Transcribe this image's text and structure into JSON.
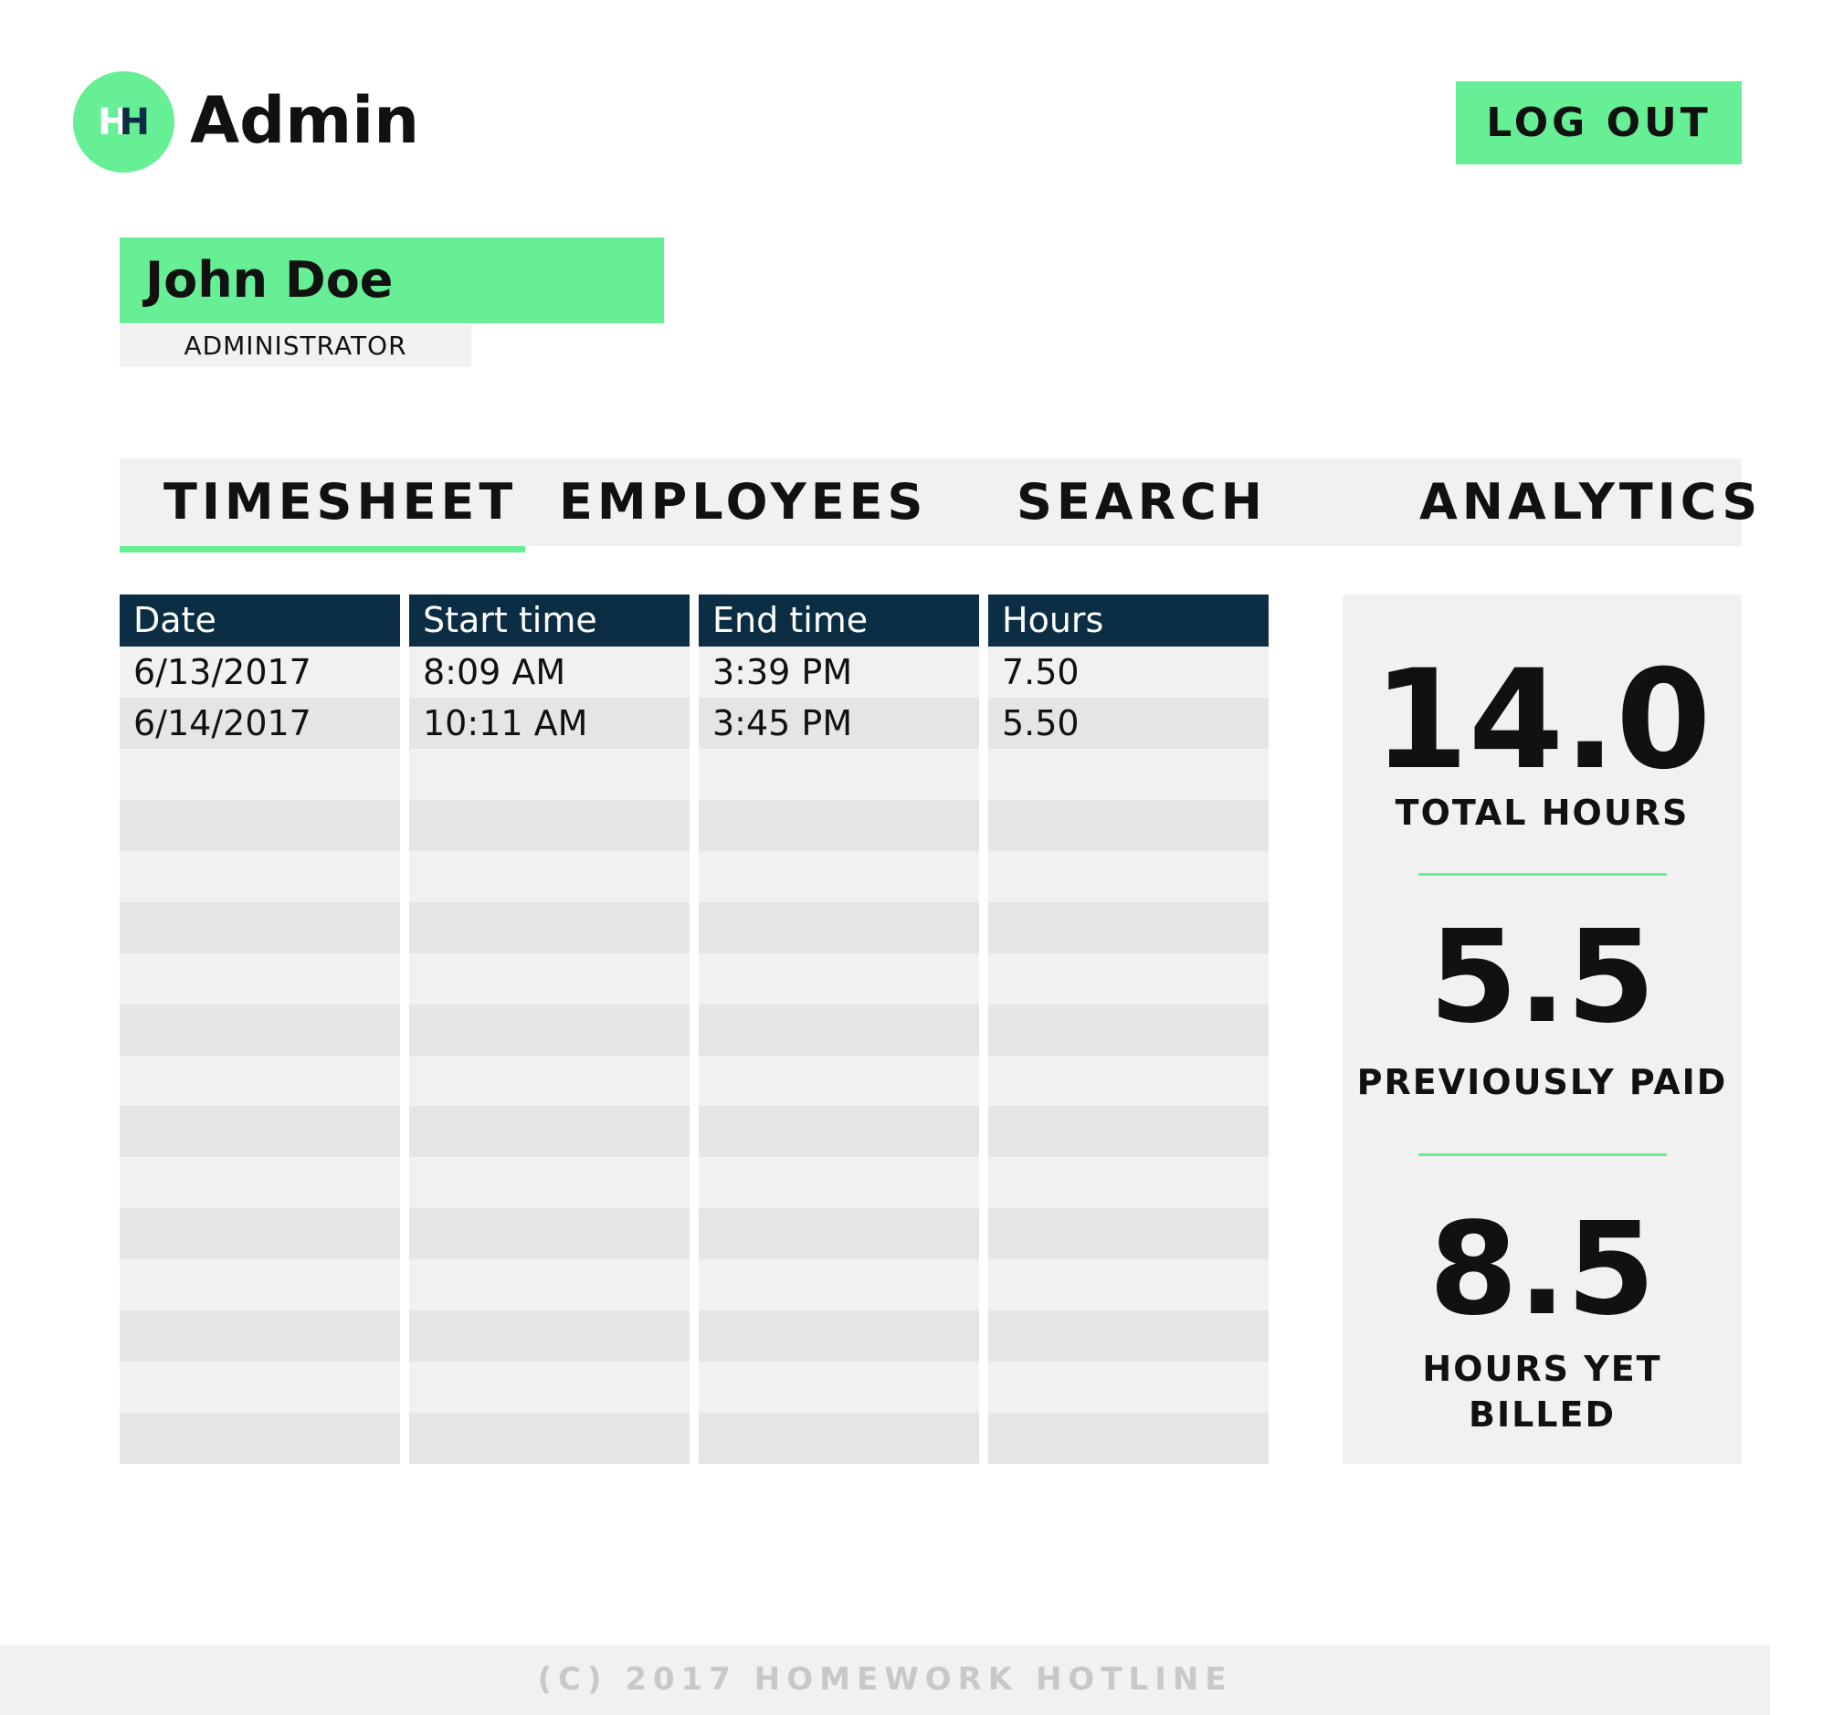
{
  "header": {
    "logo_left": "H",
    "logo_right": "H",
    "app_title": "Admin",
    "logout_label": "LOG OUT"
  },
  "user": {
    "name": "John Doe",
    "role": "ADMINISTRATOR"
  },
  "tabs": [
    {
      "label": "TIMESHEET",
      "active": true
    },
    {
      "label": "EMPLOYEES",
      "active": false
    },
    {
      "label": "SEARCH",
      "active": false
    },
    {
      "label": "ANALYTICS",
      "active": false
    }
  ],
  "timesheet": {
    "columns": [
      "Date",
      "Start time",
      "End time",
      "Hours"
    ],
    "rows": [
      [
        "6/13/2017",
        "8:09 AM",
        "3:39 PM",
        "7.50"
      ],
      [
        "6/14/2017",
        "10:11 AM",
        "3:45 PM",
        "5.50"
      ],
      [
        "",
        "",
        "",
        ""
      ],
      [
        "",
        "",
        "",
        ""
      ],
      [
        "",
        "",
        "",
        ""
      ],
      [
        "",
        "",
        "",
        ""
      ],
      [
        "",
        "",
        "",
        ""
      ],
      [
        "",
        "",
        "",
        ""
      ],
      [
        "",
        "",
        "",
        ""
      ],
      [
        "",
        "",
        "",
        ""
      ],
      [
        "",
        "",
        "",
        ""
      ],
      [
        "",
        "",
        "",
        ""
      ],
      [
        "",
        "",
        "",
        ""
      ],
      [
        "",
        "",
        "",
        ""
      ],
      [
        "",
        "",
        "",
        ""
      ],
      [
        "",
        "",
        "",
        ""
      ]
    ]
  },
  "summary": {
    "total_hours": {
      "value": "14.0",
      "label": "TOTAL HOURS"
    },
    "previously_paid": {
      "value": "5.5",
      "label": "PREVIOUSLY PAID"
    },
    "hours_yet_billed": {
      "value": "8.5",
      "label": "HOURS YET BILLED"
    }
  },
  "footer": {
    "copyright": "(C) 2017 HOMEWORK HOTLINE"
  },
  "colors": {
    "accent": "#66ef95",
    "table_header": "#0b2e44",
    "panel_bg": "#f1f1f1",
    "row_alt_bg": "#e5e5e5",
    "footer_text": "#c8c8c8"
  }
}
